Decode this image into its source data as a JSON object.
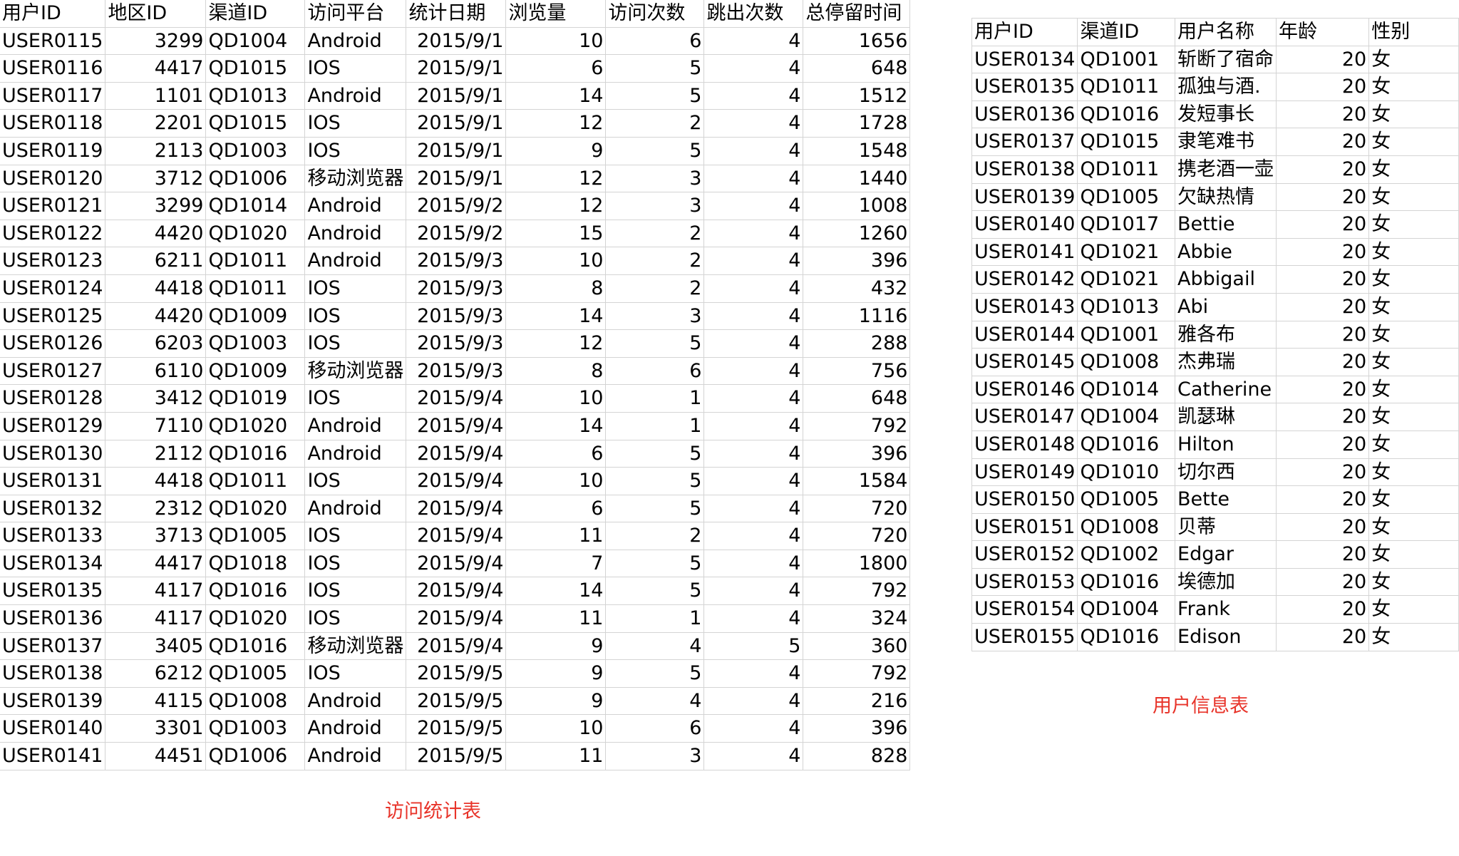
{
  "visit_table": {
    "caption": "访问统计表",
    "headers": [
      "用户ID",
      "地区ID",
      "渠道ID",
      "访问平台",
      "统计日期",
      "浏览量",
      "访问次数",
      "跳出次数",
      "总停留时间"
    ],
    "rows": [
      [
        "USER0115",
        "3299",
        "QD1004",
        "Android",
        "2015/9/1",
        "10",
        "6",
        "4",
        "1656"
      ],
      [
        "USER0116",
        "4417",
        "QD1015",
        "IOS",
        "2015/9/1",
        "6",
        "5",
        "4",
        "648"
      ],
      [
        "USER0117",
        "1101",
        "QD1013",
        "Android",
        "2015/9/1",
        "14",
        "5",
        "4",
        "1512"
      ],
      [
        "USER0118",
        "2201",
        "QD1015",
        "IOS",
        "2015/9/1",
        "12",
        "2",
        "4",
        "1728"
      ],
      [
        "USER0119",
        "2113",
        "QD1003",
        "IOS",
        "2015/9/1",
        "9",
        "5",
        "4",
        "1548"
      ],
      [
        "USER0120",
        "3712",
        "QD1006",
        "移动浏览器",
        "2015/9/1",
        "12",
        "3",
        "4",
        "1440"
      ],
      [
        "USER0121",
        "3299",
        "QD1014",
        "Android",
        "2015/9/2",
        "12",
        "3",
        "4",
        "1008"
      ],
      [
        "USER0122",
        "4420",
        "QD1020",
        "Android",
        "2015/9/2",
        "15",
        "2",
        "4",
        "1260"
      ],
      [
        "USER0123",
        "6211",
        "QD1011",
        "Android",
        "2015/9/3",
        "10",
        "2",
        "4",
        "396"
      ],
      [
        "USER0124",
        "4418",
        "QD1011",
        "IOS",
        "2015/9/3",
        "8",
        "2",
        "4",
        "432"
      ],
      [
        "USER0125",
        "4420",
        "QD1009",
        "IOS",
        "2015/9/3",
        "14",
        "3",
        "4",
        "1116"
      ],
      [
        "USER0126",
        "6203",
        "QD1003",
        "IOS",
        "2015/9/3",
        "12",
        "5",
        "4",
        "288"
      ],
      [
        "USER0127",
        "6110",
        "QD1009",
        "移动浏览器",
        "2015/9/3",
        "8",
        "6",
        "4",
        "756"
      ],
      [
        "USER0128",
        "3412",
        "QD1019",
        "IOS",
        "2015/9/4",
        "10",
        "1",
        "4",
        "648"
      ],
      [
        "USER0129",
        "7110",
        "QD1020",
        "Android",
        "2015/9/4",
        "14",
        "1",
        "4",
        "792"
      ],
      [
        "USER0130",
        "2112",
        "QD1016",
        "Android",
        "2015/9/4",
        "6",
        "5",
        "4",
        "396"
      ],
      [
        "USER0131",
        "4418",
        "QD1011",
        "IOS",
        "2015/9/4",
        "10",
        "5",
        "4",
        "1584"
      ],
      [
        "USER0132",
        "2312",
        "QD1020",
        "Android",
        "2015/9/4",
        "6",
        "5",
        "4",
        "720"
      ],
      [
        "USER0133",
        "3713",
        "QD1005",
        "IOS",
        "2015/9/4",
        "11",
        "2",
        "4",
        "720"
      ],
      [
        "USER0134",
        "4417",
        "QD1018",
        "IOS",
        "2015/9/4",
        "7",
        "5",
        "4",
        "1800"
      ],
      [
        "USER0135",
        "4117",
        "QD1016",
        "IOS",
        "2015/9/4",
        "14",
        "5",
        "4",
        "792"
      ],
      [
        "USER0136",
        "4117",
        "QD1020",
        "IOS",
        "2015/9/4",
        "11",
        "1",
        "4",
        "324"
      ],
      [
        "USER0137",
        "3405",
        "QD1016",
        "移动浏览器",
        "2015/9/4",
        "9",
        "4",
        "5",
        "360"
      ],
      [
        "USER0138",
        "6212",
        "QD1005",
        "IOS",
        "2015/9/5",
        "9",
        "5",
        "4",
        "792"
      ],
      [
        "USER0139",
        "4115",
        "QD1008",
        "Android",
        "2015/9/5",
        "9",
        "4",
        "4",
        "216"
      ],
      [
        "USER0140",
        "3301",
        "QD1003",
        "Android",
        "2015/9/5",
        "10",
        "6",
        "4",
        "396"
      ],
      [
        "USER0141",
        "4451",
        "QD1006",
        "Android",
        "2015/9/5",
        "11",
        "3",
        "4",
        "828"
      ]
    ]
  },
  "user_table": {
    "caption": "用户信息表",
    "headers": [
      "用户ID",
      "渠道ID",
      "用户名称",
      "年龄",
      "性别"
    ],
    "rows": [
      [
        "USER0134",
        "QD1001",
        "斩断了宿命",
        "20",
        "女"
      ],
      [
        "USER0135",
        "QD1011",
        "孤独与酒.",
        "20",
        "女"
      ],
      [
        "USER0136",
        "QD1016",
        "发短事长",
        "20",
        "女"
      ],
      [
        "USER0137",
        "QD1015",
        "隶笔难书",
        "20",
        "女"
      ],
      [
        "USER0138",
        "QD1011",
        "携老酒一壶",
        "20",
        "女"
      ],
      [
        "USER0139",
        "QD1005",
        "欠缺热情",
        "20",
        "女"
      ],
      [
        "USER0140",
        "QD1017",
        "Bettie",
        "20",
        "女"
      ],
      [
        "USER0141",
        "QD1021",
        "Abbie",
        "20",
        "女"
      ],
      [
        "USER0142",
        "QD1021",
        "Abbigail",
        "20",
        "女"
      ],
      [
        "USER0143",
        "QD1013",
        "Abi",
        "20",
        "女"
      ],
      [
        "USER0144",
        "QD1001",
        "雅各布",
        "20",
        "女"
      ],
      [
        "USER0145",
        "QD1008",
        "杰弗瑞",
        "20",
        "女"
      ],
      [
        "USER0146",
        "QD1014",
        "Catherine",
        "20",
        "女"
      ],
      [
        "USER0147",
        "QD1004",
        "凯瑟琳",
        "20",
        "女"
      ],
      [
        "USER0148",
        "QD1016",
        "Hilton",
        "20",
        "女"
      ],
      [
        "USER0149",
        "QD1010",
        "切尔西",
        "20",
        "女"
      ],
      [
        "USER0150",
        "QD1005",
        "Bette",
        "20",
        "女"
      ],
      [
        "USER0151",
        "QD1008",
        "贝蒂",
        "20",
        "女"
      ],
      [
        "USER0152",
        "QD1002",
        "Edgar",
        "20",
        "女"
      ],
      [
        "USER0153",
        "QD1016",
        "埃德加",
        "20",
        "女"
      ],
      [
        "USER0154",
        "QD1004",
        "Frank",
        "20",
        "女"
      ],
      [
        "USER0155",
        "QD1016",
        "Edison",
        "20",
        "女"
      ]
    ]
  }
}
